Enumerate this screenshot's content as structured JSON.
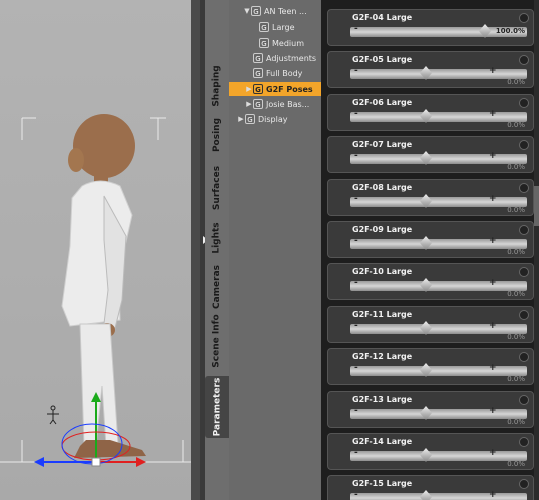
{
  "tabs": [
    "Shaping",
    "Posing",
    "Surfaces",
    "Lights",
    "Cameras",
    "Scene Info",
    "Parameters"
  ],
  "active_tab": "Parameters",
  "tree": [
    {
      "label": "AN Teen ...",
      "g": "G",
      "expand": "▼"
    },
    {
      "label": "Large",
      "g": "G",
      "expand": ""
    },
    {
      "label": "Medium",
      "g": "G",
      "expand": ""
    },
    {
      "label": "Adjustments",
      "g": "G",
      "expand": ""
    },
    {
      "label": "Full Body",
      "g": "G",
      "expand": ""
    },
    {
      "label": "G2F Poses",
      "g": "G",
      "expand": "▶"
    },
    {
      "label": "Josie Bas...",
      "g": "G",
      "expand": "▶"
    },
    {
      "label": "Display",
      "g": "G",
      "expand": "▶"
    }
  ],
  "params": [
    {
      "label": "G2F-04 Large",
      "value": "100.0%",
      "level": 1.0
    },
    {
      "label": "G2F-05 Large",
      "value": "0.0%",
      "level": 0.0
    },
    {
      "label": "G2F-06 Large",
      "value": "0.0%",
      "level": 0.0
    },
    {
      "label": "G2F-07 Large",
      "value": "0.0%",
      "level": 0.0
    },
    {
      "label": "G2F-08 Large",
      "value": "0.0%",
      "level": 0.0
    },
    {
      "label": "G2F-09 Large",
      "value": "0.0%",
      "level": 0.0
    },
    {
      "label": "G2F-10 Large",
      "value": "0.0%",
      "level": 0.0
    },
    {
      "label": "G2F-11 Large",
      "value": "0.0%",
      "level": 0.0
    },
    {
      "label": "G2F-12 Large",
      "value": "0.0%",
      "level": 0.0
    },
    {
      "label": "G2F-13 Large",
      "value": "0.0%",
      "level": 0.0
    },
    {
      "label": "G2F-14 Large",
      "value": "0.0%",
      "level": 0.0
    },
    {
      "label": "G2F-15 Large",
      "value": "",
      "level": 0.0
    }
  ],
  "colors": {
    "selected": "#f3a52a",
    "panel": "#3a3a3a"
  },
  "minus": "-",
  "plus": "+"
}
